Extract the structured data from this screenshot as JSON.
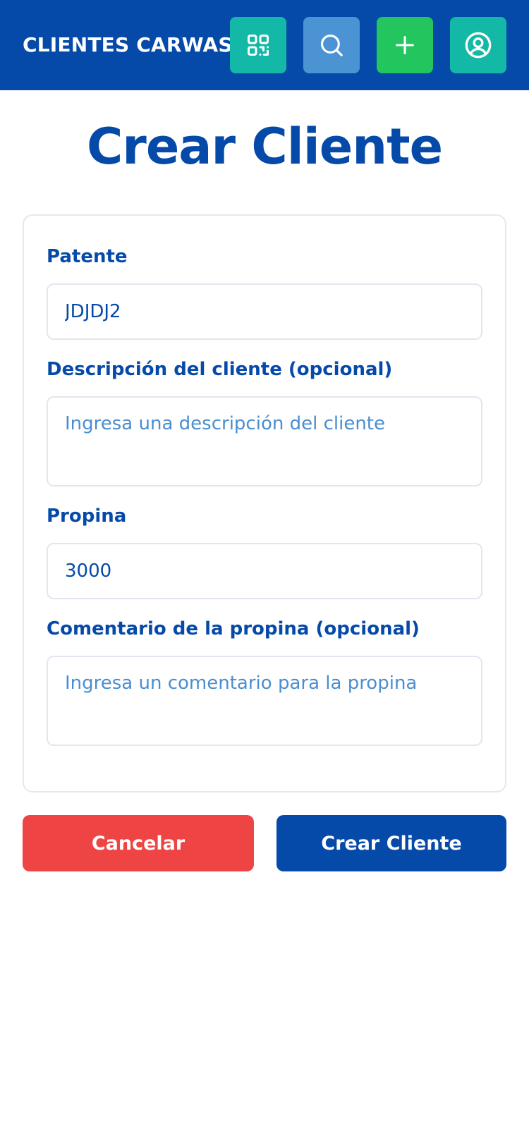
{
  "header": {
    "brand": "CLIENTES CARWASH",
    "icons": {
      "qr": "qr-code-icon",
      "search": "search-icon",
      "add": "plus-icon",
      "profile": "user-circle-icon"
    }
  },
  "page": {
    "title": "Crear Cliente"
  },
  "form": {
    "patente": {
      "label": "Patente",
      "value": "JDJDJ2"
    },
    "descripcion": {
      "label": "Descripción del cliente (opcional)",
      "value": "",
      "placeholder": "Ingresa una descripción del cliente"
    },
    "propina": {
      "label": "Propina",
      "value": "3000"
    },
    "comentario": {
      "label": "Comentario de la propina (opcional)",
      "value": "",
      "placeholder": "Ingresa un comentario para la propina"
    }
  },
  "actions": {
    "cancel_label": "Cancelar",
    "create_label": "Crear Cliente"
  },
  "colors": {
    "primary": "#054aa9",
    "teal": "#14b8a6",
    "search": "#4b93d3",
    "green": "#22c55e",
    "danger": "#ef4444",
    "placeholder": "#4a8ed0"
  }
}
